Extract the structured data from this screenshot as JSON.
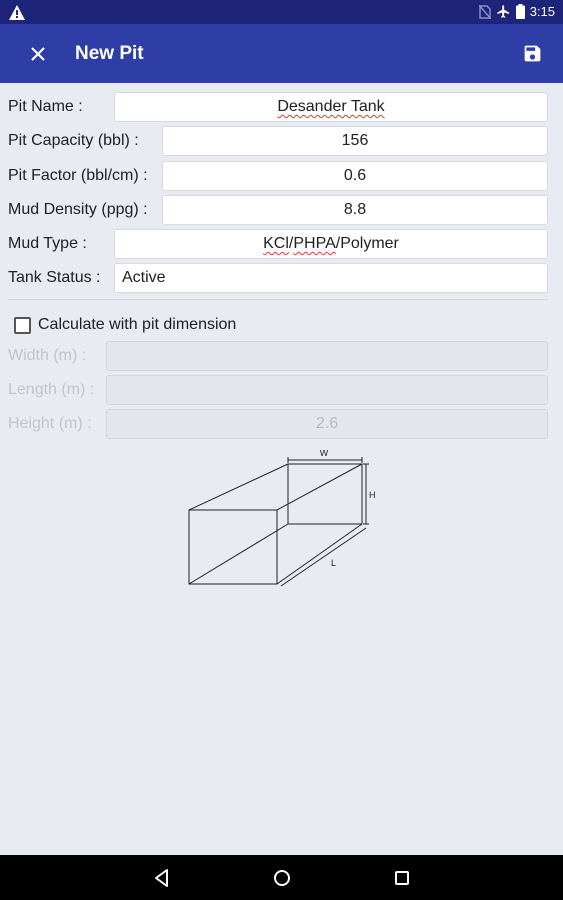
{
  "status_bar": {
    "time": "3:15",
    "icons": [
      "warning-icon",
      "no-sim-icon",
      "airplane-icon",
      "battery-icon"
    ]
  },
  "app_bar": {
    "title": "New Pit",
    "close_icon": "close-icon",
    "save_icon": "save-icon"
  },
  "form": {
    "pit_name": {
      "label": "Pit Name :",
      "value": "Desander Tank"
    },
    "pit_capacity": {
      "label": "Pit Capacity (bbl) :",
      "value": "156"
    },
    "pit_factor": {
      "label": "Pit Factor (bbl/cm) :",
      "value": "0.6"
    },
    "mud_density": {
      "label": "Mud Density (ppg) :",
      "value": "8.8"
    },
    "mud_type": {
      "label": "Mud Type :",
      "value_parts": [
        "KCl",
        "/",
        "PHPA",
        "/Polymer"
      ]
    },
    "tank_status": {
      "label": "Tank Status :",
      "value": "Active"
    }
  },
  "dimension": {
    "checkbox_label": "Calculate with pit dimension",
    "checked": false,
    "width": {
      "label": "Width (m) :",
      "value": ""
    },
    "length": {
      "label": "Length (m) :",
      "value": ""
    },
    "height": {
      "label": "Height (m) :",
      "value": "2.6"
    }
  },
  "diagram": {
    "w_label": "W",
    "h_label": "H",
    "l_label": "L"
  },
  "nav_bar": {
    "icons": [
      "back-icon",
      "home-icon",
      "recents-icon"
    ]
  },
  "colors": {
    "status_bar": "#1d247a",
    "app_bar": "#2e3ea6",
    "background": "#e9ebf3"
  }
}
